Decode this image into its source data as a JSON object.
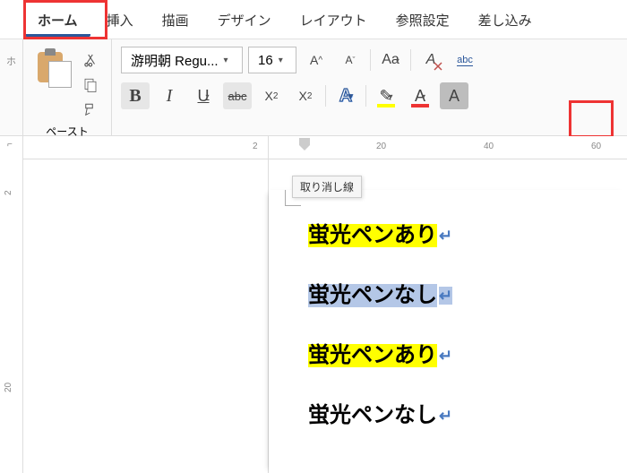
{
  "tabs": {
    "home": "ホーム",
    "insert": "挿入",
    "draw": "描画",
    "design": "デザイン",
    "layout": "レイアウト",
    "references": "参照設定",
    "mailings": "差し込み"
  },
  "clipboard": {
    "paste_label": "ペースト"
  },
  "font": {
    "name": "游明朝 Regu...",
    "size": "16",
    "grow": "A",
    "shrink": "A",
    "change_case": "Aa",
    "clear_format": "A",
    "phonetic_abc": "abc",
    "bold": "B",
    "italic": "I",
    "underline": "U",
    "strike": "abc",
    "subscript": "X",
    "subscript_sub": "2",
    "superscript": "X",
    "superscript_sup": "2",
    "text_effects": "A",
    "highlight": "✎",
    "font_color": "A",
    "char_shading": "A"
  },
  "tooltip": {
    "strike": "取り消し線"
  },
  "ruler": {
    "neg2": "2",
    "n20": "20",
    "n40": "40",
    "n60": "60",
    "v2": "2",
    "v20": "20"
  },
  "left_sliver": "ホ",
  "document": {
    "line1": "蛍光ペンあり",
    "line2": "蛍光ペンなし",
    "line3": "蛍光ペンあり",
    "line4": "蛍光ペンなし",
    "pilcrow": "↵"
  }
}
